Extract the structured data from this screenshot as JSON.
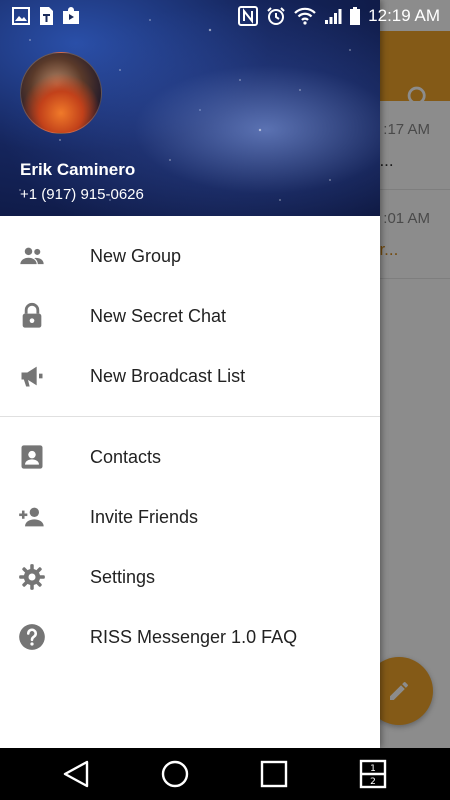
{
  "status_bar": {
    "time": "12:19 AM",
    "left_icons": [
      "gallery-icon",
      "sim-toolkit-icon",
      "shopping-bag-icon"
    ],
    "right_icons": [
      "nfc-icon",
      "alarm-icon",
      "wifi-icon",
      "signal-icon",
      "battery-icon"
    ]
  },
  "background": {
    "accent": "#f0a52a",
    "rows": [
      {
        "time": ":17 AM",
        "snippet": "o..."
      },
      {
        "time": ":01 AM",
        "snippet": "ur..."
      }
    ]
  },
  "drawer": {
    "user": {
      "name": "Erik Caminero",
      "phone": "+1 (917) 915-0626"
    },
    "menu_group_1": [
      {
        "label": "New Group",
        "icon": "group-icon"
      },
      {
        "label": "New Secret Chat",
        "icon": "lock-icon"
      },
      {
        "label": "New Broadcast List",
        "icon": "megaphone-icon"
      }
    ],
    "menu_group_2": [
      {
        "label": "Contacts",
        "icon": "contacts-icon"
      },
      {
        "label": "Invite Friends",
        "icon": "add-person-icon"
      },
      {
        "label": "Settings",
        "icon": "gear-icon"
      },
      {
        "label": "RISS Messenger 1.0 FAQ",
        "icon": "help-icon"
      }
    ]
  },
  "nav_bar": {
    "buttons": [
      "back-icon",
      "home-icon",
      "recents-icon",
      "dual-window-icon"
    ]
  }
}
